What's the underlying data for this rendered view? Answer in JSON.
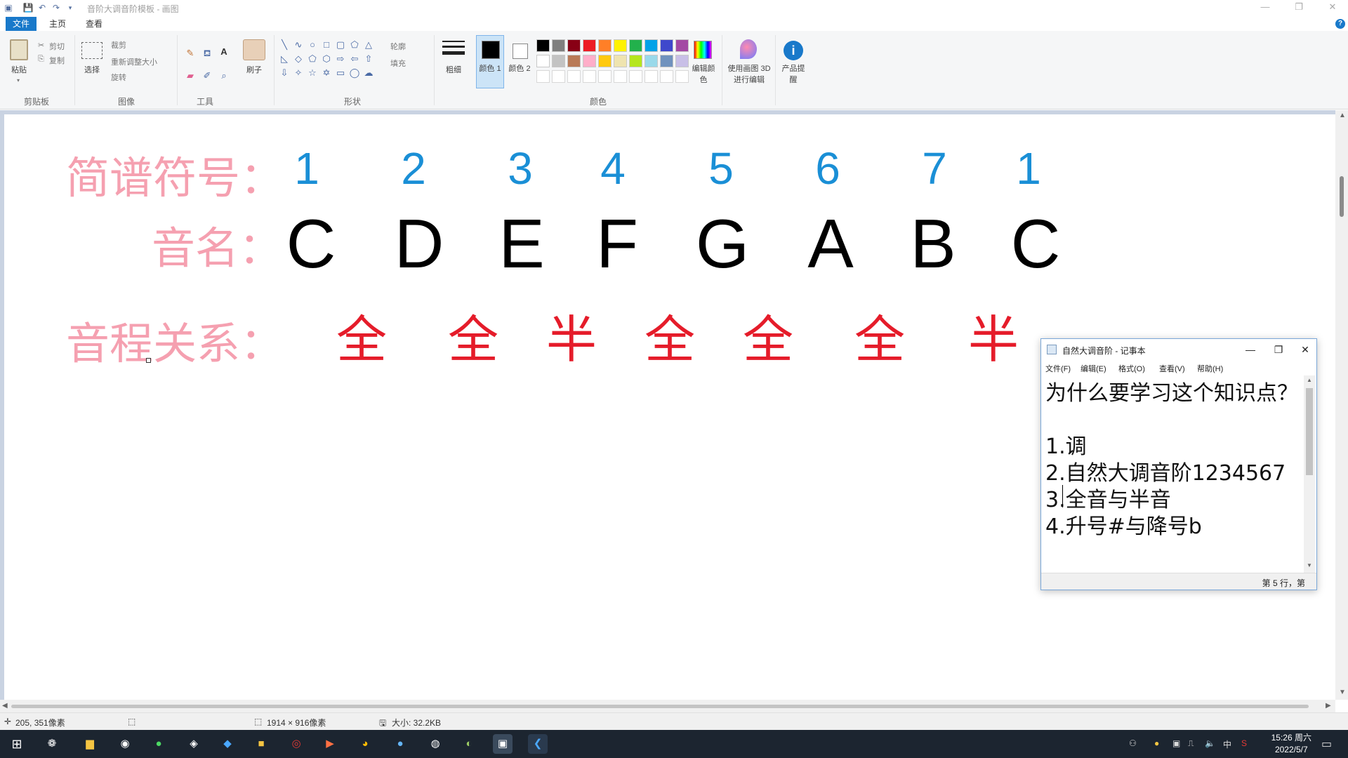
{
  "window": {
    "title": "音阶大调音阶模板 - 画图",
    "controls": [
      "—",
      "❐",
      "✕"
    ]
  },
  "ribbon": {
    "tabs": [
      "文件",
      "主页",
      "查看"
    ],
    "clipboard": {
      "paste": "粘贴",
      "cut": "剪切",
      "copy": "复制",
      "label": "剪贴板"
    },
    "image": {
      "select": "选择",
      "crop": "裁剪",
      "resize": "重新调整大小",
      "rotate": "旋转",
      "label": "图像"
    },
    "tools": {
      "label": "工具"
    },
    "brushes": {
      "label": "刷子"
    },
    "shapes": {
      "outline": "轮廓",
      "fill": "填充",
      "label": "形状"
    },
    "size": {
      "label": "粗细"
    },
    "color1": {
      "label": "颜色 1"
    },
    "color2": {
      "label": "颜色 2"
    },
    "colors": {
      "label": "颜色",
      "row1": [
        "#000000",
        "#7f7f7f",
        "#880015",
        "#ed1c24",
        "#ff7f27",
        "#fff200",
        "#22b14c",
        "#00a2e8",
        "#3f48cc",
        "#a349a4"
      ],
      "row2": [
        "#ffffff",
        "#c3c3c3",
        "#b97a57",
        "#ffaec9",
        "#ffc90e",
        "#efe4b0",
        "#b5e61d",
        "#99d9ea",
        "#7092be",
        "#c8bfe7"
      ]
    },
    "edit_colors": "编辑颜色",
    "paint3d": "使用画图 3D 进行编辑",
    "product_alert": "产品提醒"
  },
  "canvas": {
    "jianpu_label": "简谱符号：",
    "jianpu": [
      "1",
      "2",
      "3",
      "4",
      "5",
      "6",
      "7",
      "1"
    ],
    "note_label": "音名：",
    "notes": [
      "C",
      "D",
      "E",
      "F",
      "G",
      "A",
      "B",
      "C"
    ],
    "interval_label": "音程关系：",
    "intervals": [
      "全",
      "全",
      "半",
      "全",
      "全",
      "全",
      "半"
    ]
  },
  "statusbar": {
    "cursor_pos": "205, 351像素",
    "canvas_size": "1914 × 916像素",
    "file_size": "大小: 32.2KB"
  },
  "notepad": {
    "title": "自然大调音阶 - 记事本",
    "menu": [
      "文件(F)",
      "编辑(E)",
      "格式(O)",
      "查看(V)",
      "帮助(H)"
    ],
    "lines": [
      "为什么要学习这个知识点？",
      "",
      "1.调",
      "2.自然大调音阶1234567",
      "3.全音与半音",
      "4.升号#与降号b"
    ],
    "status": "第 5 行，第"
  },
  "taskbar": {
    "clock_time": "15:26 周六",
    "clock_date": "2022/5/7",
    "ime": "中"
  }
}
